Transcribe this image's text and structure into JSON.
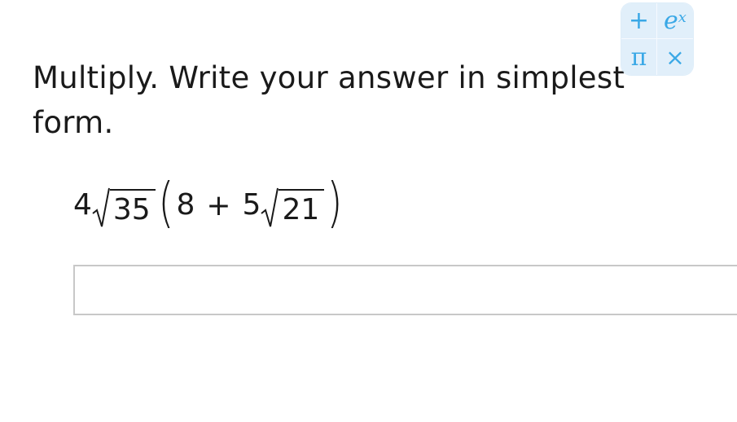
{
  "question": {
    "instruction": "Multiply. Write your answer in simplest form."
  },
  "expression": {
    "coefficient_1": "4",
    "radicand_1": "35",
    "open_paren": "(",
    "term_1": "8",
    "operator": "+",
    "coefficient_2": "5",
    "radicand_2": "21",
    "close_paren": ")"
  },
  "answer": {
    "value": "",
    "placeholder": ""
  },
  "palette": {
    "plus": "+",
    "exp_base": "e",
    "exp_power": "x",
    "pi": "π",
    "times": "×",
    "accent_color": "#3aa8e6"
  }
}
